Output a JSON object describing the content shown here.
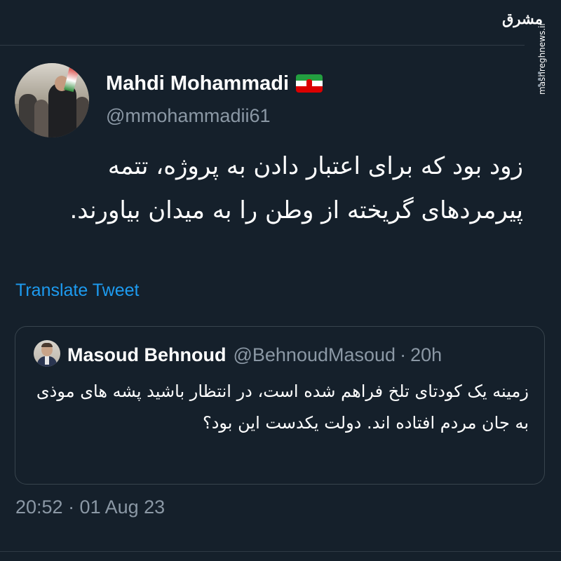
{
  "watermark": {
    "logo_text": "مشرق",
    "site": "mashreghnews.ir"
  },
  "author": {
    "display_name": "Mahdi Mohammadi",
    "handle": "@mmohammadii61",
    "flag_icon": "iran-flag-icon"
  },
  "tweet": {
    "text": "زود بود که برای اعتبار دادن به پروژه، تتمه پیرمردهای گریخته از وطن را به میدان بیاورند.",
    "translate_label": "Translate Tweet",
    "timestamp": "20:52 · 01 Aug 23"
  },
  "quote": {
    "display_name": "Masoud Behnoud",
    "handle": "@BehnoudMasoud",
    "separator": "·",
    "time": "20h",
    "text": "زمینه یک کودتای تلخ فراهم شده است، در انتظار باشید پشه های موذی به جان مردم افتاده اند. دولت یکدست این بود؟"
  },
  "colors": {
    "background": "#15202b",
    "text_primary": "#ffffff",
    "text_secondary": "#8b98a5",
    "link": "#1d9bf0",
    "border": "#38444d"
  },
  "icons": {
    "more": "more-vertical-icon"
  }
}
